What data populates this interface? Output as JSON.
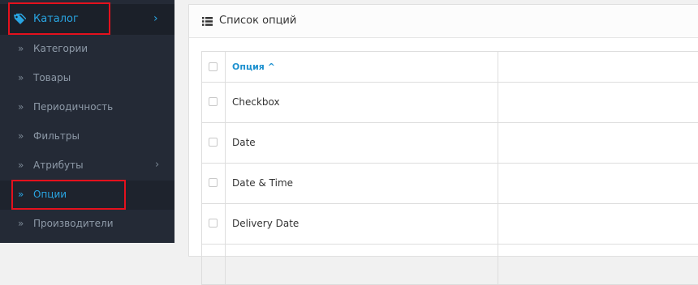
{
  "sidebar": {
    "top": {
      "label": "Каталог",
      "icon": "tag-icon",
      "chevron": "›"
    },
    "items": [
      {
        "label": "Категории",
        "arrow": "»"
      },
      {
        "label": "Товары",
        "arrow": "»"
      },
      {
        "label": "Периодичность",
        "arrow": "»"
      },
      {
        "label": "Фильтры",
        "arrow": "»"
      },
      {
        "label": "Атрибуты",
        "arrow": "»",
        "chevron": "›"
      },
      {
        "label": "Опции",
        "arrow": "»",
        "active": true
      },
      {
        "label": "Производители",
        "arrow": "»"
      }
    ]
  },
  "panel": {
    "title": "Список опций",
    "icon": "list-icon"
  },
  "table": {
    "header": {
      "name": "Опция ^"
    },
    "rows": [
      "Checkbox",
      "Date",
      "Date & Time",
      "Delivery Date"
    ]
  },
  "colors": {
    "sidebar_bg": "#242a36",
    "accent": "#29a4e1",
    "highlight": "#e4111d",
    "link": "#1e91cf"
  }
}
